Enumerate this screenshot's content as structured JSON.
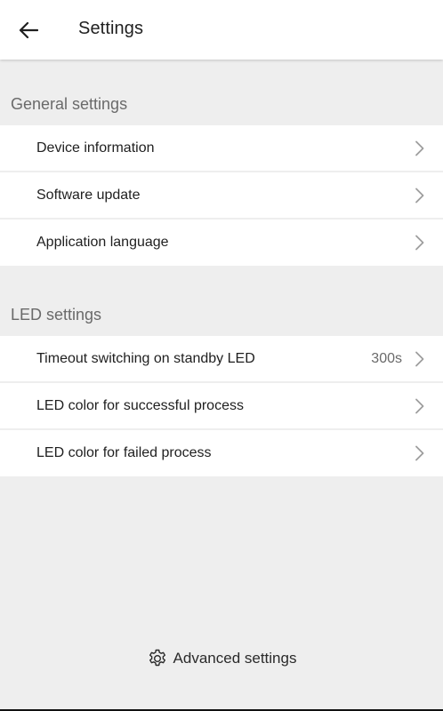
{
  "app_bar": {
    "title": "Settings",
    "back_icon": "arrow-left-icon"
  },
  "general": {
    "header": "General settings",
    "items": [
      {
        "label": "Device information",
        "value": ""
      },
      {
        "label": "Software update",
        "value": ""
      },
      {
        "label": "Application language",
        "value": ""
      }
    ]
  },
  "led": {
    "header": "LED settings",
    "items": [
      {
        "label": "Timeout switching on standby LED",
        "value": "300s"
      },
      {
        "label": "LED color for successful process",
        "value": ""
      },
      {
        "label": "LED color for failed process",
        "value": ""
      }
    ]
  },
  "advanced": {
    "label": "Advanced settings",
    "icon": "gear-icon"
  },
  "colors": {
    "background": "#eeeeee",
    "surface": "#ffffff",
    "header_text": "#6a6a6a",
    "chevron": "#9e9e9e"
  }
}
